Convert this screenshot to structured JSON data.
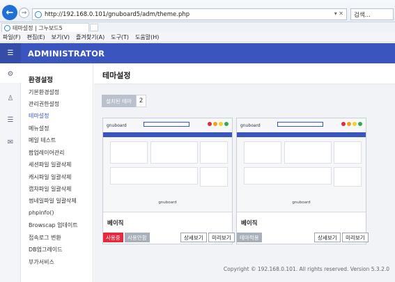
{
  "browser": {
    "url": "http://192.168.0.101/gnuboard5/adm/theme.php",
    "search_placeholder": "검색...",
    "tab_title": "테마설정 | 그누보드5",
    "menu": [
      "파일(F)",
      "편집(E)",
      "보기(V)",
      "즐겨찾기(A)",
      "도구(T)",
      "도움말(H)"
    ]
  },
  "header": {
    "brand": "ADMINISTRATOR"
  },
  "sidebar": {
    "title": "환경설정",
    "items": [
      "기본환경설정",
      "관리권한설정",
      "테마설정",
      "메뉴설정",
      "메일 테스트",
      "팝업레이어관리",
      "세션파일 일괄삭제",
      "캐시파일 일괄삭제",
      "캡챠파일 일괄삭제",
      "썸네일파일 일괄삭제",
      "phpinfo()",
      "Browscap 업데이트",
      "접속로그 변환",
      "DB업그레이드",
      "부가서비스"
    ],
    "active_index": 2
  },
  "main": {
    "title": "테마설정",
    "installed_label": "설치된 테마",
    "installed_count": "2",
    "themes": [
      {
        "name": "베이직",
        "preview_logo": "gnuboard",
        "preview_footer": "gnuboard",
        "buttons": [
          "사용중",
          "사용안함",
          "상세보기",
          "미리보기"
        ]
      },
      {
        "name": "베이직",
        "preview_logo": "gnuboard",
        "preview_footer": "gnuboard",
        "buttons": [
          "테마적용",
          "상세보기",
          "미리보기"
        ]
      }
    ],
    "copyright": "Copyright © 192.168.0.101. All rights reserved. Version 5.3.2.0"
  },
  "colors": {
    "header": "#3b55bf",
    "primary_red": "#e8283d",
    "disabled_gray": "#a7afba"
  },
  "icons": [
    "back-arrow-icon",
    "forward-arrow-icon",
    "menu-icon",
    "gear-icon",
    "user-icon",
    "list-icon",
    "mail-icon"
  ]
}
